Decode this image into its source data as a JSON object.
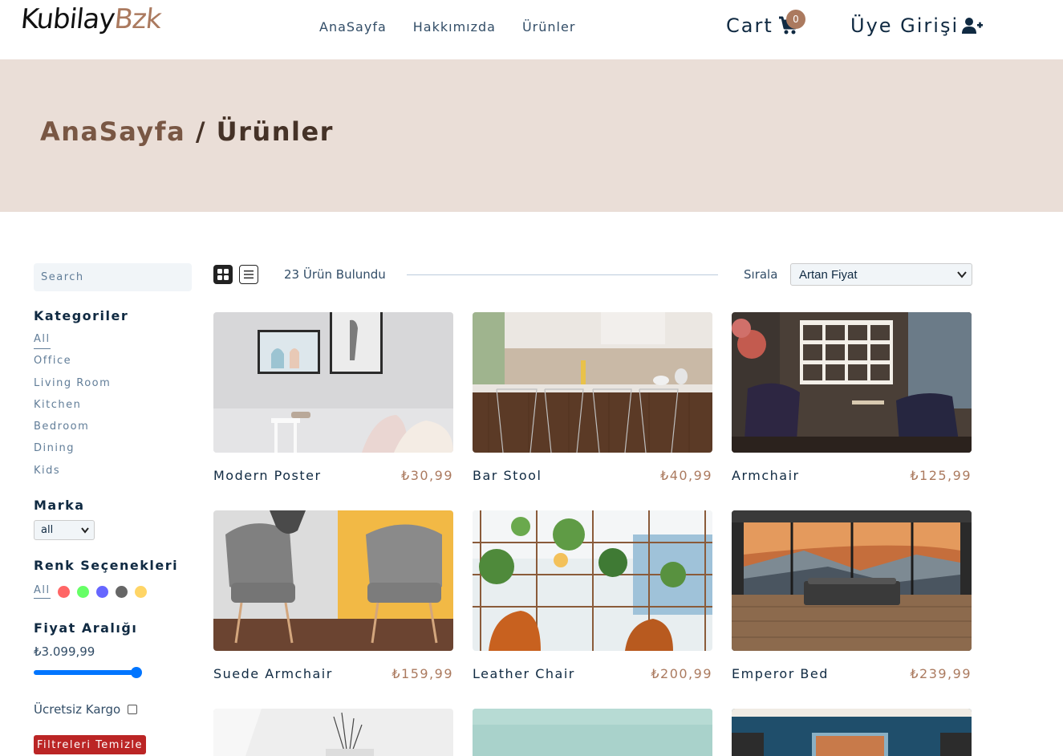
{
  "navbar": {
    "logo_part1": "Kubilay",
    "logo_part2": "Bzk",
    "links": [
      "AnaSayfa",
      "Hakkımızda",
      "Ürünler"
    ],
    "cart_label": "Cart",
    "cart_count": "0",
    "login_label": "Üye Girişi"
  },
  "hero": {
    "crumb": "AnaSayfa",
    "separator": " / ",
    "current": "Ürünler"
  },
  "filters": {
    "search_placeholder": "Search",
    "categories_title": "Kategoriler",
    "categories": [
      "All",
      "Office",
      "Living Room",
      "Kitchen",
      "Bedroom",
      "Dining",
      "Kids"
    ],
    "brand_title": "Marka",
    "brand_selected": "all",
    "colors_title": "Renk Seçenekleri",
    "colors_all": "All",
    "colors": [
      "#ff0000",
      "#00ff00",
      "#0000ff",
      "#000000",
      "#ffb900"
    ],
    "price_title": "Fiyat Aralığı",
    "price_value": "₺3.099,99",
    "price_level": 1.0,
    "shipping_label": "Ücretsiz Kargo",
    "clear_label": "Filtreleri Temizle"
  },
  "sort": {
    "found_text": "23 Ürün Bulundu",
    "sort_label": "Sırala",
    "sort_selected": "Artan Fiyat"
  },
  "products": [
    {
      "name": "Modern Poster",
      "price": "₺30,99"
    },
    {
      "name": "Bar Stool",
      "price": "₺40,99"
    },
    {
      "name": "Armchair",
      "price": "₺125,99"
    },
    {
      "name": "Suede Armchair",
      "price": "₺159,99"
    },
    {
      "name": "Leather Chair",
      "price": "₺200,99"
    },
    {
      "name": "Emperor Bed",
      "price": "₺239,99"
    }
  ],
  "colors": {
    "accent": "#ab7a5f",
    "hero_bg": "#eaded7",
    "danger": "#bb2525",
    "range": "#0075ff"
  }
}
